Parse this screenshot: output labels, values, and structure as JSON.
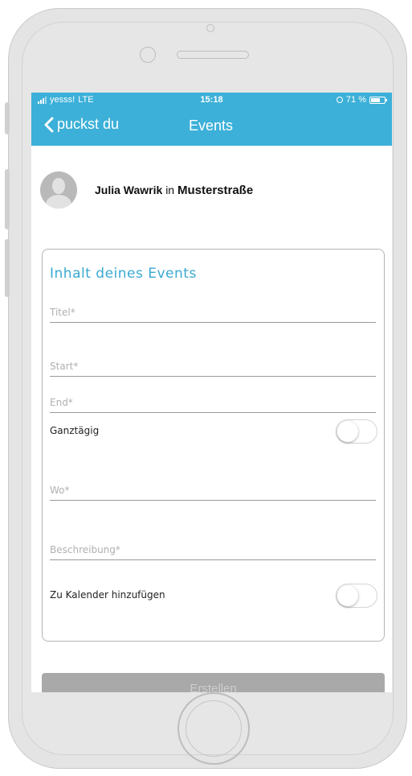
{
  "status_bar": {
    "carrier": "yesss!",
    "network": "LTE",
    "time": "15:18",
    "battery_percent": "71 %",
    "battery_level": 0.71
  },
  "nav": {
    "back_label": "puckst du",
    "title": "Events"
  },
  "author": {
    "name": "Julia Wawrik",
    "connector": "in",
    "street": "Musterstraße"
  },
  "form": {
    "title": "Inhalt deines Events",
    "fields": {
      "title_placeholder": "Titel*",
      "start_placeholder": "Start*",
      "end_placeholder": "End*",
      "location_placeholder": "Wo*",
      "description_placeholder": "Beschreibung*"
    },
    "all_day": {
      "label": "Ganztägig",
      "on": false
    },
    "add_to_calendar": {
      "label": "Zu Kalender hinzufügen",
      "on": false
    }
  },
  "submit_label": "Erstellen",
  "colors": {
    "accent": "#3cb0d8",
    "button_disabled": "#a9a9a9"
  },
  "icons": [
    "signal-icon",
    "alarm-icon",
    "battery-icon",
    "chevron-left-icon",
    "avatar-placeholder-icon"
  ]
}
